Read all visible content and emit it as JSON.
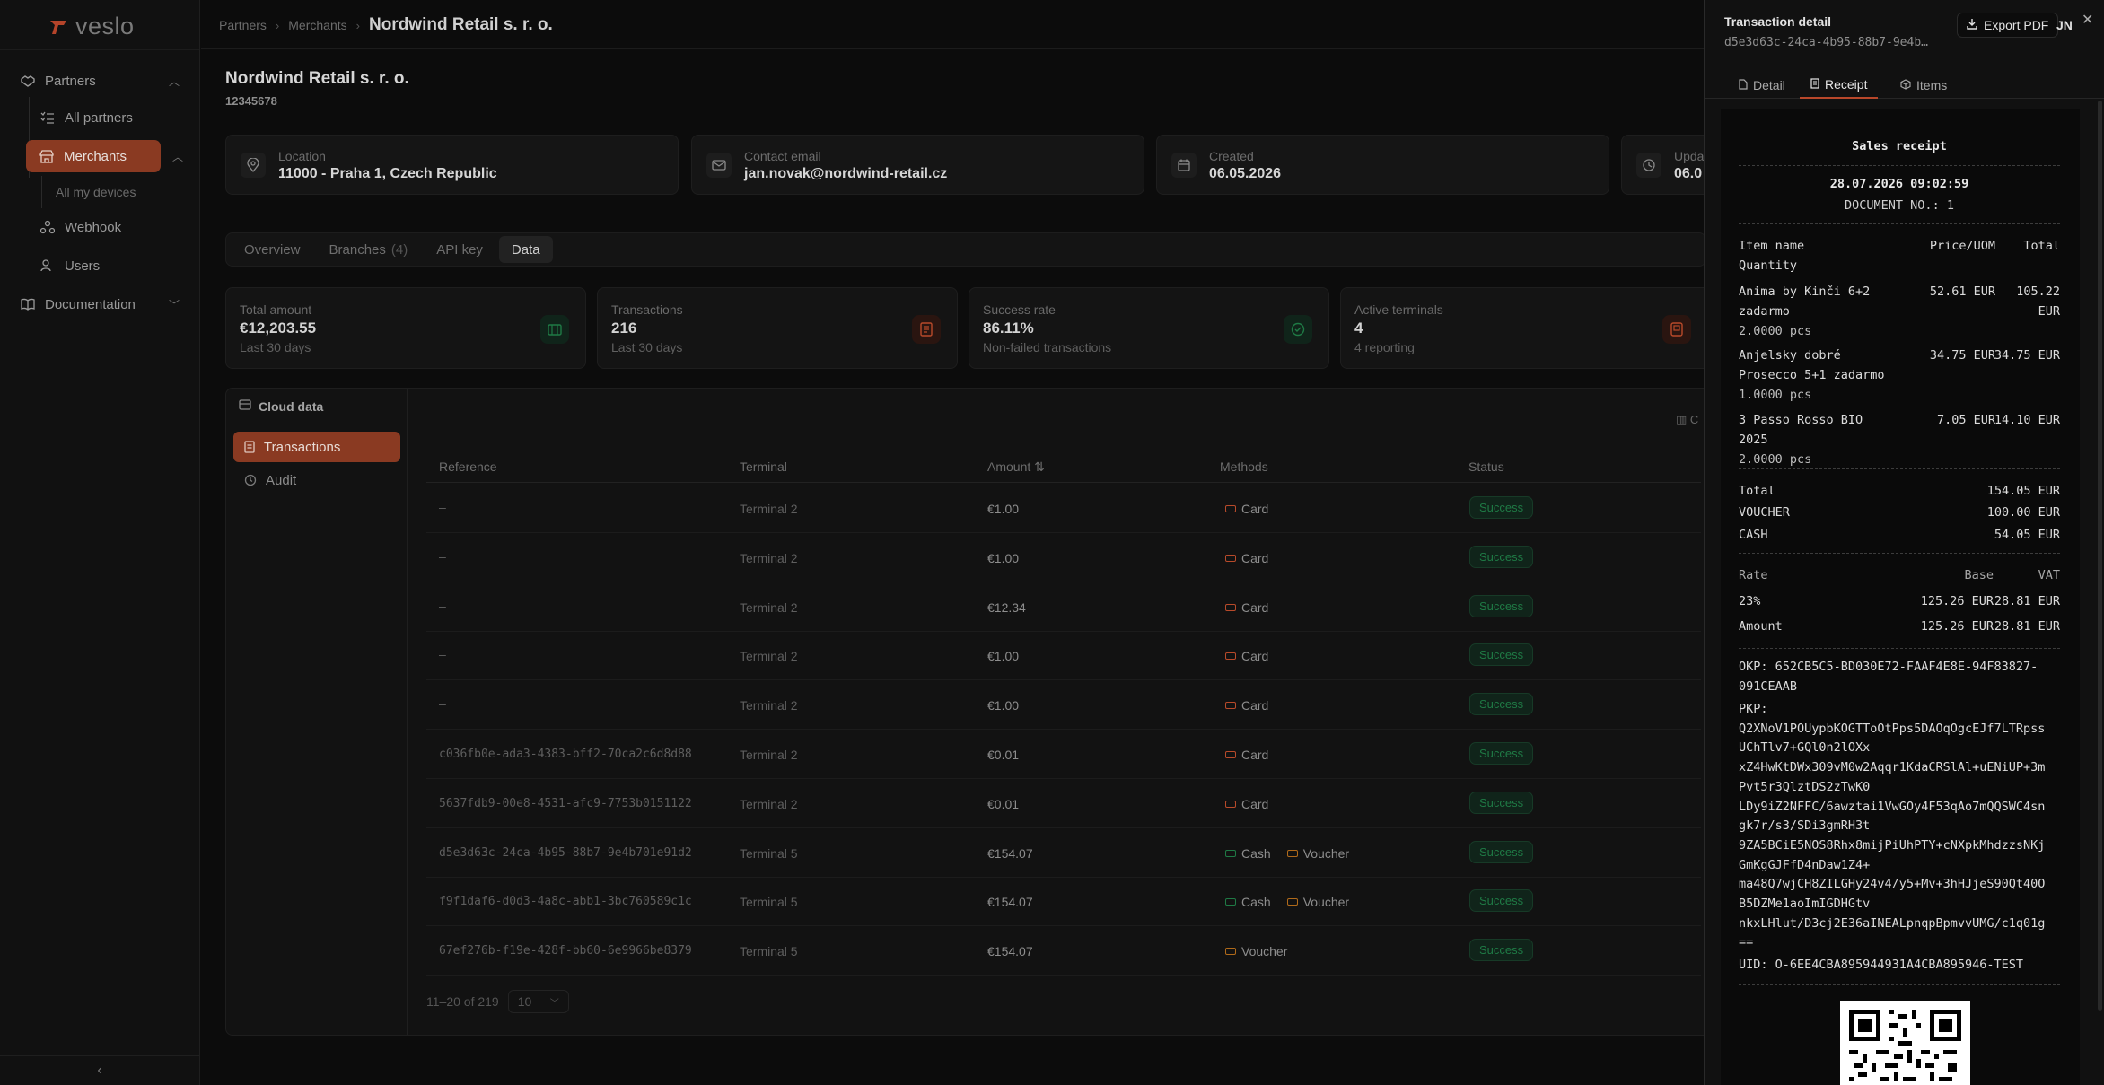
{
  "app": {
    "logo_text": "veslo"
  },
  "sidebar": {
    "partners_label": "Partners",
    "all_partners_label": "All partners",
    "merchants_label": "Merchants",
    "all_devices_label": "All my devices",
    "webhook_label": "Webhook",
    "users_label": "Users",
    "documentation_label": "Documentation",
    "collapse_glyph": "‹"
  },
  "breadcrumb": {
    "item1": "Partners",
    "item2": "Merchants",
    "current": "Nordwind Retail s. r. o."
  },
  "merchant": {
    "name": "Nordwind Retail s. r. o.",
    "id": "12345678",
    "location_label": "Location",
    "location_value": "11000 - Praha 1, Czech Republic",
    "email_label": "Contact email",
    "email_value": "jan.novak@nordwind-retail.cz",
    "created_label": "Created",
    "created_value": "06.05.2026",
    "updated_label": "Upda",
    "updated_value": "06.0"
  },
  "tabs": {
    "overview": "Overview",
    "branches": "Branches",
    "branches_count": "(4)",
    "apikey": "API key",
    "data": "Data"
  },
  "stats": [
    {
      "label": "Total amount",
      "value": "€12,203.55",
      "sub": "Last 30 days",
      "color": "#1f7a45"
    },
    {
      "label": "Transactions",
      "value": "216",
      "sub": "Last 30 days",
      "color": "#b84a2a"
    },
    {
      "label": "Success rate",
      "value": "86.11%",
      "sub": "Non-failed transactions",
      "color": "#1f7a45"
    },
    {
      "label": "Active terminals",
      "value": "4",
      "sub": "4 reporting",
      "color": "#b84a2a"
    }
  ],
  "cloud": {
    "header": "Cloud data",
    "transactions": "Transactions",
    "audit": "Audit"
  },
  "table": {
    "columns": {
      "reference": "Reference",
      "terminal": "Terminal",
      "amount": "Amount",
      "methods": "Methods",
      "status": "Status"
    },
    "cols_glyph": "C",
    "rows": [
      {
        "ref": "–",
        "terminal": "Terminal 2",
        "amount": "€1.00",
        "m1": "Card",
        "m2": "",
        "status": "Success"
      },
      {
        "ref": "–",
        "terminal": "Terminal 2",
        "amount": "€1.00",
        "m1": "Card",
        "m2": "",
        "status": "Success"
      },
      {
        "ref": "–",
        "terminal": "Terminal 2",
        "amount": "€12.34",
        "m1": "Card",
        "m2": "",
        "status": "Success"
      },
      {
        "ref": "–",
        "terminal": "Terminal 2",
        "amount": "€1.00",
        "m1": "Card",
        "m2": "",
        "status": "Success"
      },
      {
        "ref": "–",
        "terminal": "Terminal 2",
        "amount": "€1.00",
        "m1": "Card",
        "m2": "",
        "status": "Success"
      },
      {
        "ref": "c036fb0e-ada3-4383-bff2-70ca2c6d8d88",
        "terminal": "Terminal 2",
        "amount": "€0.01",
        "m1": "Card",
        "m2": "",
        "status": "Success"
      },
      {
        "ref": "5637fdb9-00e8-4531-afc9-7753b0151122",
        "terminal": "Terminal 2",
        "amount": "€0.01",
        "m1": "Card",
        "m2": "",
        "status": "Success"
      },
      {
        "ref": "d5e3d63c-24ca-4b95-88b7-9e4b701e91d2",
        "terminal": "Terminal 5",
        "amount": "€154.07",
        "m1": "Cash",
        "m2": "Voucher",
        "status": "Success"
      },
      {
        "ref": "f9f1daf6-d0d3-4a8c-abb1-3bc760589c1c",
        "terminal": "Terminal 5",
        "amount": "€154.07",
        "m1": "Cash",
        "m2": "Voucher",
        "status": "Success"
      },
      {
        "ref": "67ef276b-f19e-428f-bb60-6e9966be8379",
        "terminal": "Terminal 5",
        "amount": "€154.07",
        "m1": "Voucher",
        "m2": "",
        "status": "Success"
      }
    ],
    "pager_text": "11–20 of 219",
    "page_size": "10"
  },
  "drawer": {
    "title": "Transaction detail",
    "id": "d5e3d63c-24ca-4b95-88b7-9e4b…",
    "export_label": "Export PDF",
    "user_initials": "JN",
    "close_glyph": "✕",
    "tabs": {
      "detail": "Detail",
      "receipt": "Receipt",
      "items": "Items"
    }
  },
  "receipt": {
    "title": "Sales receipt",
    "datetime": "28.07.2026 09:02:59",
    "doc_no": "DOCUMENT NO.: 1",
    "hdr_item": "Item name",
    "hdr_price": "Price/UOM",
    "hdr_total": "Total",
    "hdr_qty": "Quantity",
    "items": [
      {
        "name1": "Anima by Kinči 6+2",
        "name2": "zadarmo",
        "price": "52.61 EUR",
        "total1": "105.22",
        "total2": "EUR",
        "qty": "2.0000 pcs"
      },
      {
        "name1": "Anjelsky dobré",
        "name2": "Prosecco 5+1 zadarmo",
        "price": "34.75 EUR",
        "total1": "34.75 EUR",
        "total2": "",
        "qty": "1.0000 pcs"
      },
      {
        "name1": "3 Passo Rosso BIO",
        "name2": "2025",
        "price": "7.05 EUR",
        "total1": "14.10 EUR",
        "total2": "",
        "qty": "2.0000 pcs"
      }
    ],
    "total_label": "Total",
    "total_value": "154.05 EUR",
    "voucher_label": "VOUCHER",
    "voucher_value": "100.00 EUR",
    "cash_label": "CASH",
    "cash_value": "54.05 EUR",
    "vat_rate_h": "Rate",
    "vat_base_h": "Base",
    "vat_vat_h": "VAT",
    "vat_rate": "23%",
    "vat_base": "125.26 EUR",
    "vat_vat": "28.81 EUR",
    "amt_label": "Amount",
    "amt_base": "125.26 EUR",
    "amt_vat": "28.81 EUR",
    "okp1": "OKP: 652CB5C5-BD030E72-FAAF4E8E-94F83827-",
    "okp2": "091CEAAB",
    "pkp_lines": [
      "PKP:",
      "Q2XNoV1POUypbKOGTToOtPps5DAOqOgcEJf7LTRpss",
      "UChTlv7+GQl0n2lOXx",
      "xZ4HwKtDWx309vM0w2Aqqr1KdaCRSlAl+uENiUP+3m",
      "Pvt5r3QlztDS2zTwK0",
      "LDy9iZ2NFFC/6awztai1VwGOy4F53qAo7mQQSWC4sn",
      "gk7r/s3/SDi3gmRH3t",
      "9ZA5BCiE5NOS8Rhx8mijPiUhPTY+cNXpkMhdzzsNKj",
      "GmKgGJFfD4nDaw1Z4+",
      "ma48Q7wjCH8ZILGHy24v4/y5+Mv+3hHJjeS90Qt40O",
      "B5DZMe1aoImIGDHGtv",
      "nkxLHlut/D3cj2E36aINEALpnqpBpmvvUMG/c1q01g",
      "=="
    ],
    "uid": "UID: O-6EE4CBA895944931A4CBA895946-TEST"
  }
}
